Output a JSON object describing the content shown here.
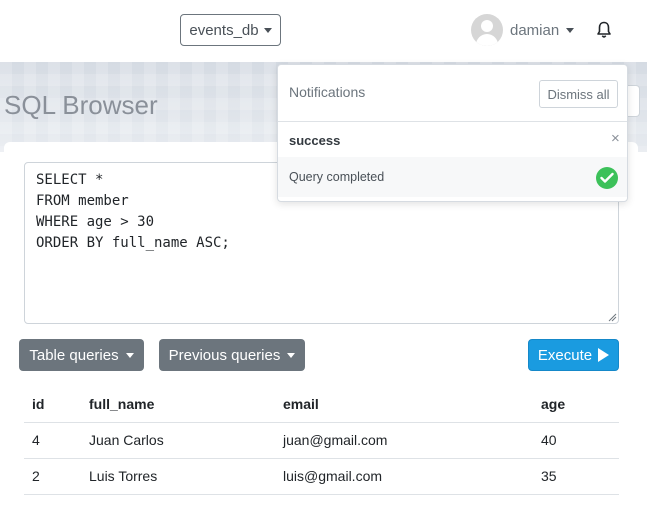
{
  "navbar": {
    "database": "events_db",
    "user": "damian"
  },
  "page": {
    "title": "SQL Browser"
  },
  "editor": {
    "query": "SELECT *\nFROM member\nWHERE age > 30\nORDER BY full_name ASC;"
  },
  "toolbar": {
    "table_queries": "Table queries",
    "previous_queries": "Previous queries",
    "execute": "Execute"
  },
  "results": {
    "columns": [
      "id",
      "full_name",
      "email",
      "age"
    ],
    "rows": [
      [
        "4",
        "Juan Carlos",
        "juan@gmail.com",
        "40"
      ],
      [
        "2",
        "Luis Torres",
        "luis@gmail.com",
        "35"
      ]
    ]
  },
  "notifications": {
    "title": "Notifications",
    "dismiss_all": "Dismiss all",
    "items": [
      {
        "type": "success",
        "message": "Query completed",
        "icon": "check-circle-icon",
        "color": "#3cc15a"
      }
    ]
  },
  "colors": {
    "primary": "#1a9be0",
    "secondary": "#6c757d",
    "success": "#3cc15a"
  }
}
